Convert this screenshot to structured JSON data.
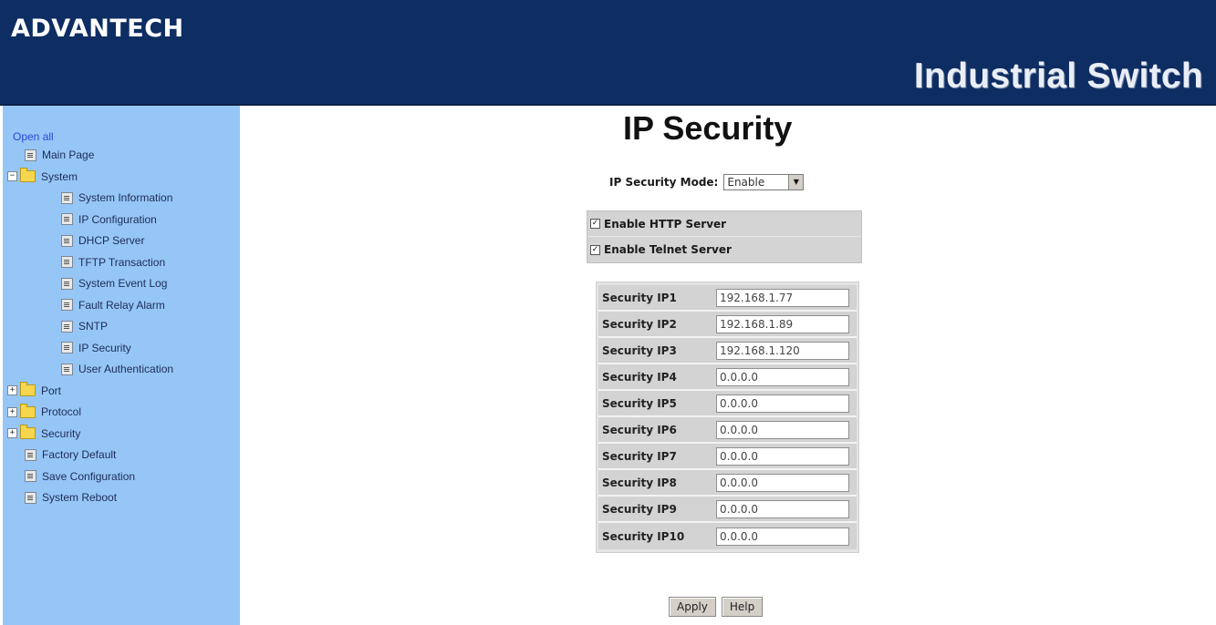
{
  "header": {
    "brand": "ADVANTECH",
    "product": "Industrial Switch"
  },
  "sidebar": {
    "open_all": "Open all",
    "items": [
      {
        "label": "Main Page",
        "type": "page",
        "level": 0
      },
      {
        "label": "System",
        "type": "folder",
        "expanded": true,
        "level": 0
      },
      {
        "label": "System Information",
        "type": "page",
        "level": 1
      },
      {
        "label": "IP Configuration",
        "type": "page",
        "level": 1
      },
      {
        "label": "DHCP Server",
        "type": "page",
        "level": 1
      },
      {
        "label": "TFTP Transaction",
        "type": "page",
        "level": 1
      },
      {
        "label": "System Event Log",
        "type": "page",
        "level": 1
      },
      {
        "label": "Fault Relay Alarm",
        "type": "page",
        "level": 1
      },
      {
        "label": "SNTP",
        "type": "page",
        "level": 1
      },
      {
        "label": "IP Security",
        "type": "page",
        "level": 1
      },
      {
        "label": "User Authentication",
        "type": "page",
        "level": 1
      },
      {
        "label": "Port",
        "type": "folder",
        "expanded": false,
        "level": 0
      },
      {
        "label": "Protocol",
        "type": "folder",
        "expanded": false,
        "level": 0
      },
      {
        "label": "Security",
        "type": "folder",
        "expanded": false,
        "level": 0
      },
      {
        "label": "Factory Default",
        "type": "page",
        "level": 0
      },
      {
        "label": "Save Configuration",
        "type": "page",
        "level": 0
      },
      {
        "label": "System Reboot",
        "type": "page",
        "level": 0
      }
    ]
  },
  "main": {
    "title": "IP Security",
    "mode_label": "IP Security Mode:",
    "mode_value": "Enable",
    "checkboxes": [
      {
        "label": "Enable HTTP Server",
        "checked": true
      },
      {
        "label": "Enable Telnet Server",
        "checked": true
      }
    ],
    "security_ips": [
      {
        "label": "Security IP1",
        "value": "192.168.1.77"
      },
      {
        "label": "Security IP2",
        "value": "192.168.1.89"
      },
      {
        "label": "Security IP3",
        "value": "192.168.1.120"
      },
      {
        "label": "Security IP4",
        "value": "0.0.0.0"
      },
      {
        "label": "Security IP5",
        "value": "0.0.0.0"
      },
      {
        "label": "Security IP6",
        "value": "0.0.0.0"
      },
      {
        "label": "Security IP7",
        "value": "0.0.0.0"
      },
      {
        "label": "Security IP8",
        "value": "0.0.0.0"
      },
      {
        "label": "Security IP9",
        "value": "0.0.0.0"
      },
      {
        "label": "Security IP10",
        "value": "0.0.0.0"
      }
    ],
    "apply_label": "Apply",
    "help_label": "Help"
  },
  "colors": {
    "header_bg": "#0e2d63",
    "sidebar_bg": "#96c6f6",
    "open_all_link": "#2b49d6"
  }
}
